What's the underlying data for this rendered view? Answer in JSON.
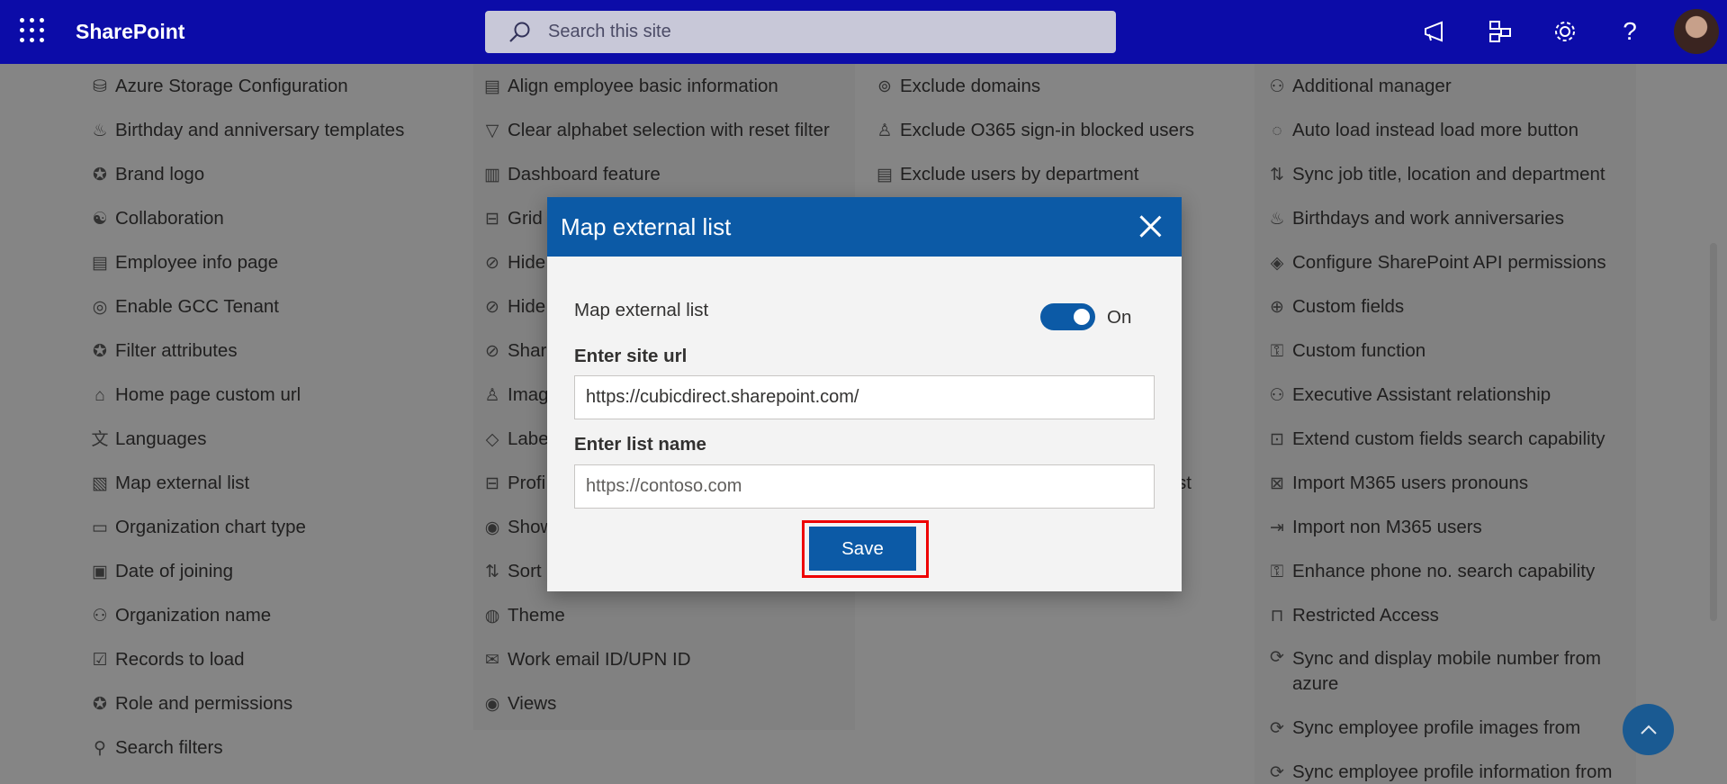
{
  "app": {
    "title": "SharePoint"
  },
  "search": {
    "placeholder": "Search this site"
  },
  "columns": {
    "col1": [
      {
        "label": "Azure Storage Configuration",
        "icon": "database-icon"
      },
      {
        "label": "Birthday and anniversary templates",
        "icon": "cake-icon"
      },
      {
        "label": "Brand logo",
        "icon": "badge-icon"
      },
      {
        "label": "Collaboration",
        "icon": "collaboration-icon"
      },
      {
        "label": "Employee info page",
        "icon": "document-person-icon"
      },
      {
        "label": "Enable GCC Tenant",
        "icon": "globe-icon"
      },
      {
        "label": "Filter attributes",
        "icon": "badge-icon"
      },
      {
        "label": "Home page custom url",
        "icon": "home-icon"
      },
      {
        "label": "Languages",
        "icon": "languages-icon"
      },
      {
        "label": "Map external list",
        "icon": "map-list-icon"
      },
      {
        "label": "Organization chart type",
        "icon": "chart-icon"
      },
      {
        "label": "Date of joining",
        "icon": "calendar-icon"
      },
      {
        "label": "Organization name",
        "icon": "org-icon"
      },
      {
        "label": "Records to load",
        "icon": "records-icon"
      },
      {
        "label": "Role and permissions",
        "icon": "badge-icon"
      },
      {
        "label": "Search filters",
        "icon": "search-icon"
      }
    ],
    "col2": [
      {
        "label": "Align employee basic information",
        "icon": "align-icon"
      },
      {
        "label": "Clear alphabet selection with reset filter",
        "icon": "filter-icon"
      },
      {
        "label": "Dashboard feature",
        "icon": "bar-chart-icon"
      },
      {
        "label": "Grid",
        "icon": "grid-icon"
      },
      {
        "label": "Hide",
        "icon": "hide-icon"
      },
      {
        "label": "Hide",
        "icon": "hide-icon"
      },
      {
        "label": "Shar",
        "icon": "hide-icon"
      },
      {
        "label": "Imag",
        "icon": "person-icon"
      },
      {
        "label": "Labe",
        "icon": "tag-icon"
      },
      {
        "label": "Profi",
        "icon": "grid-icon"
      },
      {
        "label": "Show",
        "icon": "eye-icon"
      },
      {
        "label": "Sort",
        "icon": "sort-icon"
      },
      {
        "label": "Theme",
        "icon": "palette-icon"
      },
      {
        "label": "Work email ID/UPN ID",
        "icon": "mail-icon"
      },
      {
        "label": "Views",
        "icon": "eye-icon"
      }
    ],
    "col3": [
      {
        "label": "Exclude domains",
        "icon": "broadcast-icon"
      },
      {
        "label": "Exclude O365 sign-in blocked users",
        "icon": "person-block-icon"
      },
      {
        "label": "Exclude users by department",
        "icon": "document-icon"
      }
    ],
    "col3_partial": "st",
    "col4": [
      {
        "label": "Additional manager",
        "icon": "people-icon"
      },
      {
        "label": "Auto load instead load more button",
        "icon": "loading-icon"
      },
      {
        "label": "Sync job title, location and department",
        "icon": "sync-arrows-icon"
      },
      {
        "label": "Birthdays and work anniversaries",
        "icon": "cake-icon"
      },
      {
        "label": "Configure SharePoint API permissions",
        "icon": "permissions-icon"
      },
      {
        "label": "Custom fields",
        "icon": "plus-circle-icon"
      },
      {
        "label": "Custom function",
        "icon": "key-icon"
      },
      {
        "label": "Executive Assistant relationship",
        "icon": "people-icon"
      },
      {
        "label": "Extend custom fields search capability",
        "icon": "search-box-icon"
      },
      {
        "label": "Import M365 users pronouns",
        "icon": "pronouns-icon"
      },
      {
        "label": "Import non M365 users",
        "icon": "import-icon"
      },
      {
        "label": "Enhance phone no. search capability",
        "icon": "key-icon"
      },
      {
        "label": "Restricted Access",
        "icon": "lock-icon"
      },
      {
        "label": "Sync and display mobile number from azure",
        "icon": "sync-icon"
      },
      {
        "label": "Sync employee profile images from",
        "icon": "sync-icon"
      },
      {
        "label": "Sync employee profile information from",
        "icon": "sync-icon"
      }
    ]
  },
  "modal": {
    "title": "Map external list",
    "toggle_label": "Map external list",
    "toggle_state": "On",
    "toggle_on": true,
    "site_url_label": "Enter site url",
    "site_url_value": "https://cubicdirect.sharepoint.com/",
    "list_name_label": "Enter list name",
    "list_name_placeholder": "https://contoso.com",
    "save_label": "Save"
  }
}
